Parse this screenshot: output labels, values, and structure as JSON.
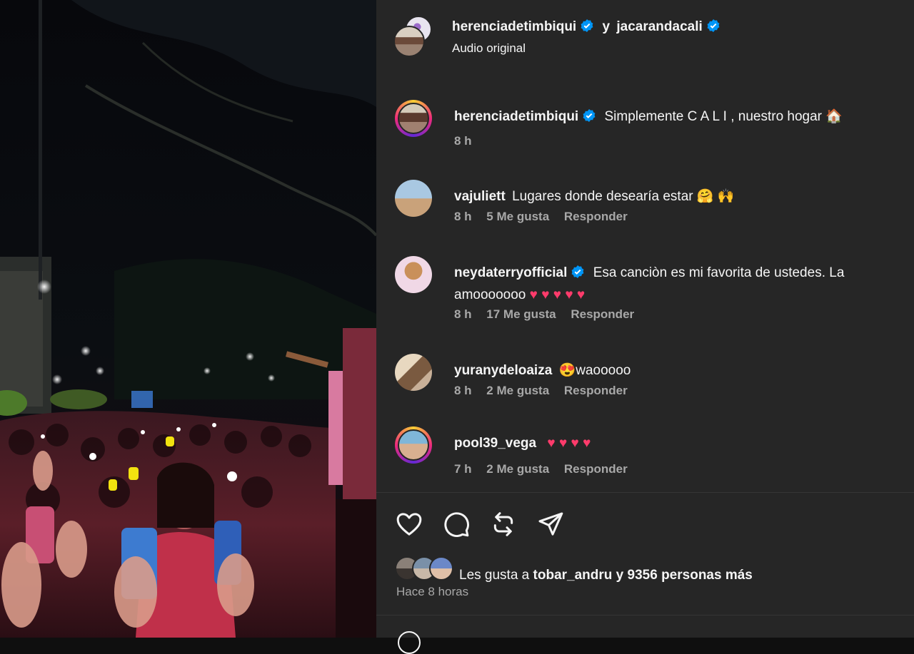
{
  "post": {
    "author1": "herenciadetimbiqui",
    "conjunction": "y",
    "author2": "jacarandacali",
    "audio": "Audio original",
    "caption": {
      "user": "herenciadetimbiqui",
      "text": "Simplemente C A L I , nuestro hogar 🏠",
      "time": "8 h"
    }
  },
  "comments": [
    {
      "user": "vajuliett",
      "verified": false,
      "text": "Lugares donde desearía estar 🤗 🙌",
      "time": "8 h",
      "likes": "5 Me gusta",
      "reply": "Responder"
    },
    {
      "user": "neydaterryofficial",
      "verified": true,
      "text": "Esa canciòn es mi favorita de ustedes. La amooooooo",
      "hearts": "♥ ♥ ♥ ♥ ♥",
      "time": "8 h",
      "likes": "17 Me gusta",
      "reply": "Responder"
    },
    {
      "user": "yuranydeloaiza",
      "verified": false,
      "text": "😍waooooo",
      "time": "8 h",
      "likes": "2 Me gusta",
      "reply": "Responder"
    },
    {
      "user": "pool39_vega",
      "verified": false,
      "text": "",
      "hearts": "♥ ♥ ♥ ♥",
      "time": "7 h",
      "likes": "2 Me gusta",
      "reply": "Responder"
    }
  ],
  "footer": {
    "likes_prefix": "Les gusta a",
    "likes_user": "tobar_andru",
    "likes_mid": "y",
    "likes_count": "9356 personas más",
    "posted": "Hace 8 horas"
  },
  "icons": {
    "like": "heart-icon",
    "comment": "comment-icon",
    "repost": "repost-icon",
    "share": "share-icon",
    "verified": "verified-badge-icon"
  },
  "colors": {
    "panel_bg": "#262626",
    "verified": "#0095f6",
    "muted": "#a8a8a8",
    "heart": "#ff3b6b"
  }
}
